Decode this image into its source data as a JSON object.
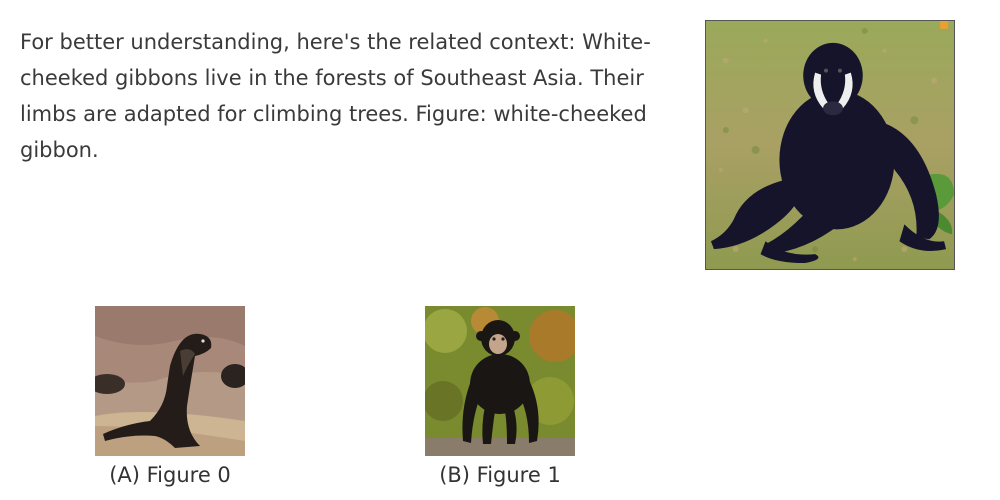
{
  "context": {
    "text": "For better understanding, here's the related context: White-cheeked gibbons live in the forests of Southeast Asia. Their limbs are adapted for climbing trees. Figure: white-cheeked gibbon."
  },
  "main_image": {
    "icon": "white-cheeked-gibbon-photo"
  },
  "options": [
    {
      "label": "(A) Figure 0",
      "icon": "sea-lion-photo"
    },
    {
      "label": "(B) Figure 1",
      "icon": "chimpanzee-photo"
    }
  ],
  "colors": {
    "text": "#3a3a3a",
    "grass": "#8a9a48",
    "sand": "#b79a7a",
    "foliage": "#6f7a2a"
  }
}
